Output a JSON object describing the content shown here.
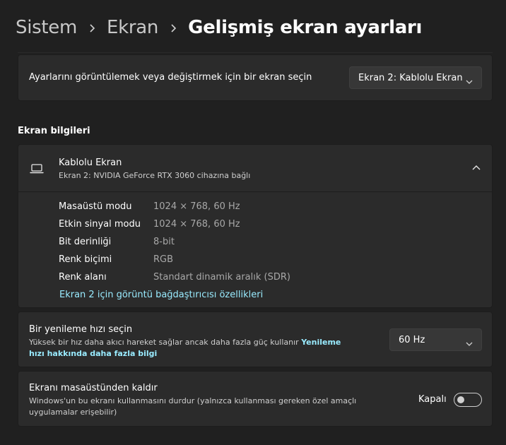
{
  "breadcrumb": {
    "items": [
      "Sistem",
      "Ekran"
    ],
    "current": "Gelişmiş ekran ayarları"
  },
  "display_select": {
    "label": "Ayarlarını görüntülemek veya değiştirmek için bir ekran seçin",
    "value": "Ekran 2: Kablolu Ekran"
  },
  "section_title": "Ekran bilgileri",
  "display_info": {
    "icon": "laptop-icon",
    "title": "Kablolu Ekran",
    "subtitle": "Ekran 2: NVIDIA GeForce RTX 3060 cihazına bağlı",
    "properties": [
      {
        "label": "Masaüstü modu",
        "value": "1024 × 768, 60 Hz"
      },
      {
        "label": "Etkin sinyal modu",
        "value": "1024 × 768, 60 Hz"
      },
      {
        "label": "Bit derinliği",
        "value": "8-bit"
      },
      {
        "label": "Renk biçimi",
        "value": "RGB"
      },
      {
        "label": "Renk alanı",
        "value": "Standart dinamik aralık (SDR)"
      }
    ],
    "adapter_link": "Ekran 2 için görüntü bağdaştırıcısı özellikleri"
  },
  "refresh_rate": {
    "title": "Bir yenileme hızı seçin",
    "description": "Yüksek bir hız daha akıcı hareket sağlar ancak daha fazla güç kullanır ",
    "link": "Yenileme hızı hakkında daha fazla bilgi",
    "value": "60 Hz"
  },
  "remove_display": {
    "title": "Ekranı masaüstünden kaldır",
    "description": "Windows'un bu ekranı kullanmasını durdur (yalnızca kullanması gereken özel amaçlı uygulamalar erişebilir)",
    "toggle_label": "Kapalı",
    "toggle_on": false
  },
  "colors": {
    "background": "#202020",
    "card": "#2b2b2b",
    "link": "#99ebff"
  }
}
